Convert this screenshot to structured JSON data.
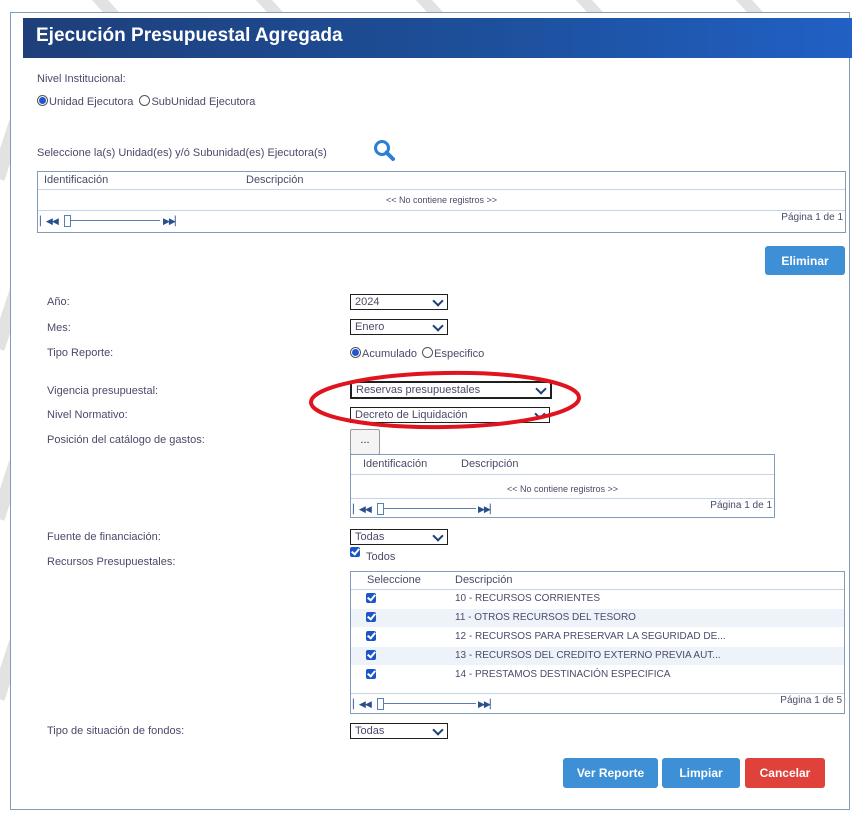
{
  "header": {
    "title": "Ejecución Presupuestal Agregada"
  },
  "nivel": {
    "label": "Nivel Institucional:",
    "options": [
      "Unidad Ejecutora",
      "SubUnidad Ejecutora"
    ],
    "selected": "Unidad Ejecutora"
  },
  "unidades": {
    "label": "Seleccione la(s) Unidad(es) y/ó Subunidad(es) Ejecutora(s)",
    "search_icon": "search-icon",
    "columns": [
      "Identificación",
      "Descripción"
    ],
    "empty": "<< No contiene registros >>",
    "pager": "Página 1 de 1",
    "delete_button": "Eliminar"
  },
  "form": {
    "anio": {
      "label": "Año:",
      "value": "2024"
    },
    "mes": {
      "label": "Mes:",
      "value": "Enero"
    },
    "tipo_reporte": {
      "label": "Tipo Reporte:",
      "options": [
        "Acumulado",
        "Especifico"
      ],
      "selected": "Acumulado"
    },
    "vigencia": {
      "label": "Vigencia presupuestal:",
      "value": "Reservas presupuestales"
    },
    "nivel_normativo": {
      "label": "Nivel Normativo:",
      "value": "Decreto de Liquidación"
    },
    "posicion": {
      "label": "Posición del catálogo de gastos:",
      "button": "...",
      "columns": [
        "Identificación",
        "Descripción"
      ],
      "empty": "<< No contiene registros >>",
      "pager": "Página 1 de 1"
    },
    "fuente": {
      "label": "Fuente de financiación:",
      "value": "Todas"
    },
    "recursos": {
      "label": "Recursos Presupuestales:",
      "todos": "Todos",
      "columns": [
        "Seleccione",
        "Descripción"
      ],
      "rows": [
        "10 - RECURSOS CORRIENTES",
        "11 - OTROS RECURSOS DEL TESORO",
        "12 - RECURSOS PARA PRESERVAR LA SEGURIDAD DE...",
        "13 - RECURSOS DEL CREDITO EXTERNO PREVIA AUT...",
        "14 - PRESTAMOS DESTINACIÓN ESPECIFICA"
      ],
      "pager": "Página 1 de 5"
    },
    "situacion": {
      "label": "Tipo de situación de fondos:",
      "value": "Todas"
    }
  },
  "actions": {
    "report": "Ver Reporte",
    "clear": "Limpiar",
    "cancel": "Cancelar"
  },
  "colors": {
    "header": "#1e3f7a",
    "button_blue": "#3d8fd6",
    "button_red": "#e0413a",
    "annotation": "#e0141e"
  }
}
